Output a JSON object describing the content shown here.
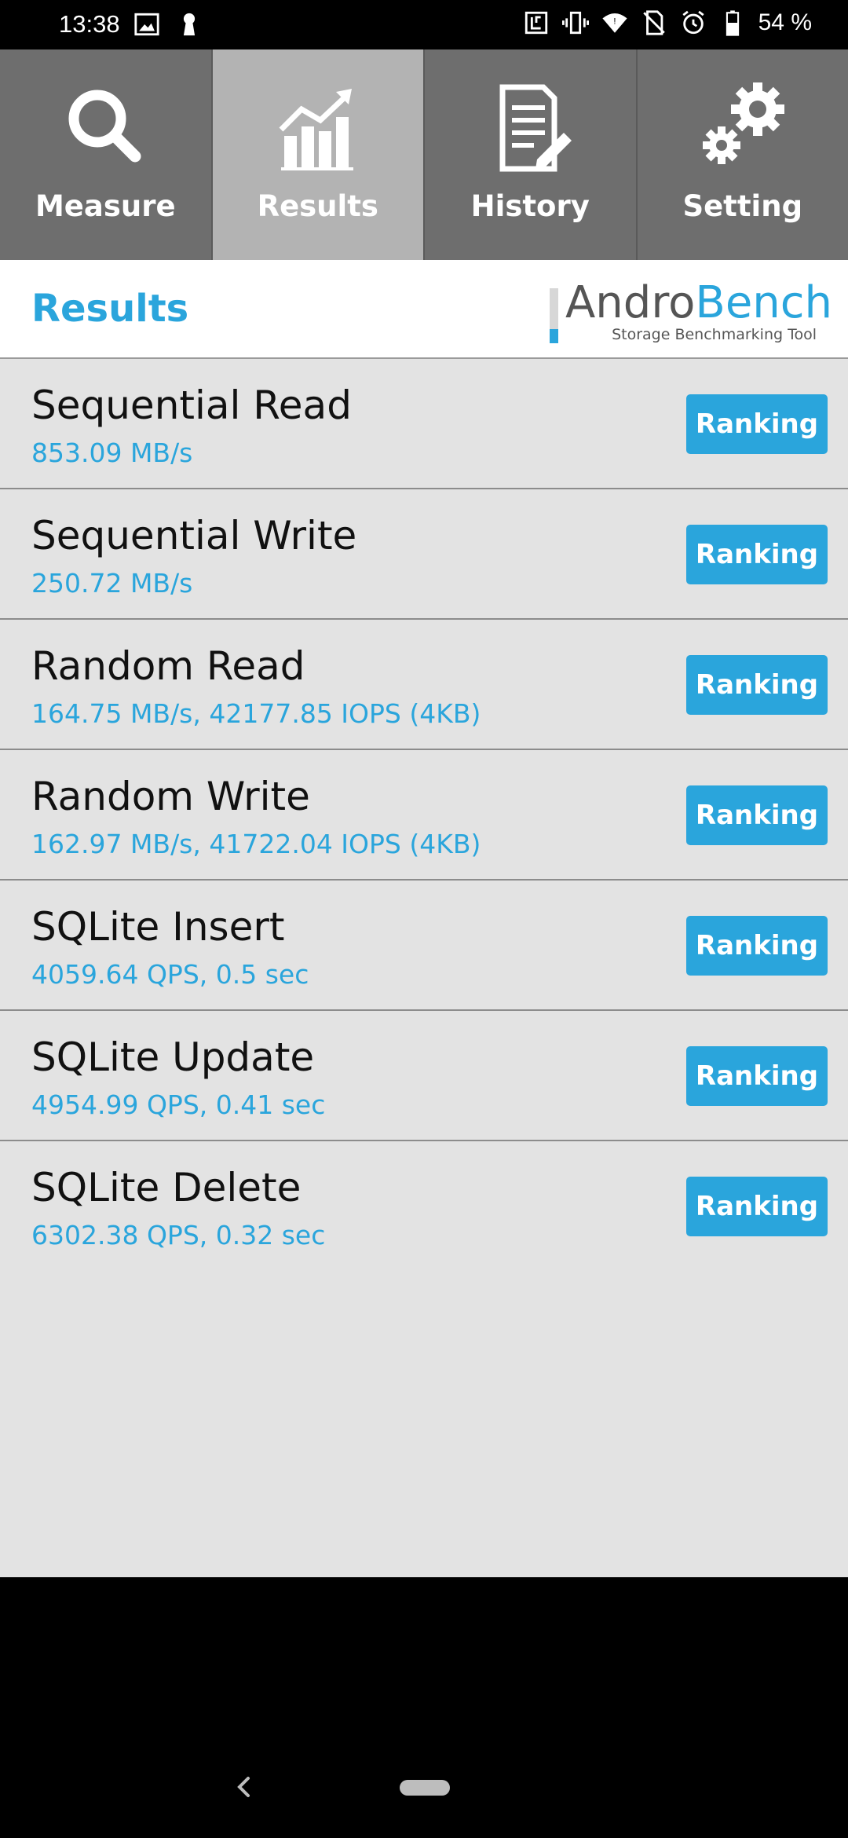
{
  "status_bar": {
    "time": "13:38",
    "battery": "54 %",
    "icons": [
      "image-icon",
      "keyhole-icon",
      "nfc-icon",
      "vibrate-icon",
      "wifi-icon",
      "no-sim-icon",
      "alarm-icon",
      "battery-icon"
    ]
  },
  "tabs": [
    {
      "label": "Measure",
      "icon": "search-icon",
      "active": false
    },
    {
      "label": "Results",
      "icon": "chart-icon",
      "active": true
    },
    {
      "label": "History",
      "icon": "document-edit-icon",
      "active": false
    },
    {
      "label": "Setting",
      "icon": "gears-icon",
      "active": false
    }
  ],
  "header": {
    "title": "Results",
    "logo_andro": "Andro",
    "logo_bench": "Bench",
    "logo_subtitle": "Storage Benchmarking Tool"
  },
  "results": [
    {
      "name": "Sequential Read",
      "value": "853.09 MB/s",
      "button": "Ranking"
    },
    {
      "name": "Sequential Write",
      "value": "250.72 MB/s",
      "button": "Ranking"
    },
    {
      "name": "Random Read",
      "value": "164.75 MB/s, 42177.85 IOPS (4KB)",
      "button": "Ranking"
    },
    {
      "name": "Random Write",
      "value": "162.97 MB/s, 41722.04 IOPS (4KB)",
      "button": "Ranking"
    },
    {
      "name": "SQLite Insert",
      "value": "4059.64 QPS, 0.5 sec",
      "button": "Ranking"
    },
    {
      "name": "SQLite Update",
      "value": "4954.99 QPS, 0.41 sec",
      "button": "Ranking"
    },
    {
      "name": "SQLite Delete",
      "value": "6302.38 QPS, 0.32 sec",
      "button": "Ranking"
    }
  ],
  "colors": {
    "accent": "#2aa5dc",
    "tab_bg": "#6e6e6e",
    "tab_active_bg": "#b3b3b3",
    "list_bg": "#e3e3e3"
  }
}
